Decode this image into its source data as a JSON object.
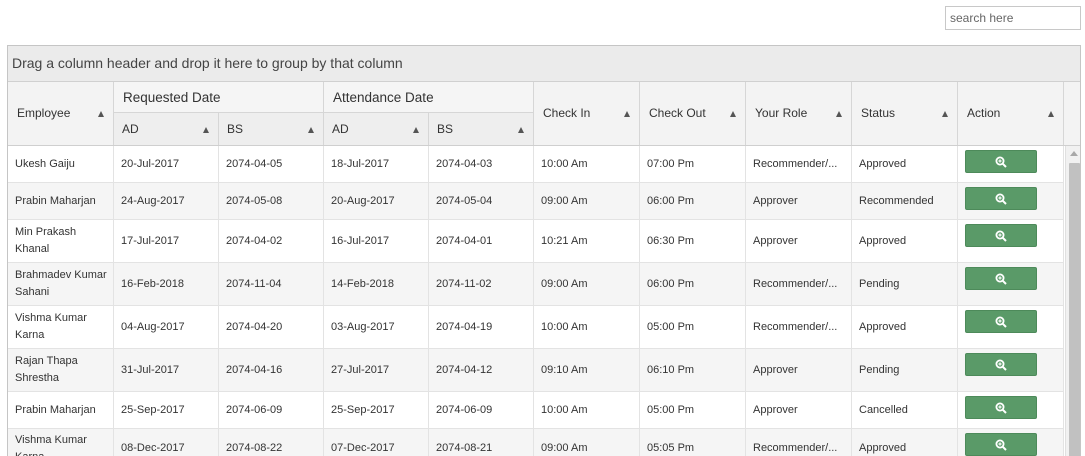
{
  "search": {
    "placeholder": "search here"
  },
  "grid": {
    "group_hint": "Drag a column header and drop it here to group by that column",
    "headers": {
      "employee": "Employee",
      "requested_date": "Requested Date",
      "attendance_date": "Attendance Date",
      "ad": "AD",
      "bs": "BS",
      "check_in": "Check In",
      "check_out": "Check Out",
      "your_role": "Your Role",
      "status": "Status",
      "action": "Action"
    },
    "rows": [
      {
        "employee": "Ukesh Gaiju",
        "req_ad": "20-Jul-2017",
        "req_bs": "2074-04-05",
        "att_ad": "18-Jul-2017",
        "att_bs": "2074-04-03",
        "check_in": "10:00 Am",
        "check_out": "07:00 Pm",
        "role": "Recommender/...",
        "status": "Approved"
      },
      {
        "employee": "Prabin Maharjan",
        "req_ad": "24-Aug-2017",
        "req_bs": "2074-05-08",
        "att_ad": "20-Aug-2017",
        "att_bs": "2074-05-04",
        "check_in": "09:00 Am",
        "check_out": "06:00 Pm",
        "role": "Approver",
        "status": "Recommended"
      },
      {
        "employee": "Min Prakash Khanal",
        "req_ad": "17-Jul-2017",
        "req_bs": "2074-04-02",
        "att_ad": "16-Jul-2017",
        "att_bs": "2074-04-01",
        "check_in": "10:21 Am",
        "check_out": "06:30 Pm",
        "role": "Approver",
        "status": "Approved"
      },
      {
        "employee": "Brahmadev Kumar Sahani",
        "req_ad": "16-Feb-2018",
        "req_bs": "2074-11-04",
        "att_ad": "14-Feb-2018",
        "att_bs": "2074-11-02",
        "check_in": "09:00 Am",
        "check_out": "06:00 Pm",
        "role": "Recommender/...",
        "status": "Pending"
      },
      {
        "employee": "Vishma Kumar Karna",
        "req_ad": "04-Aug-2017",
        "req_bs": "2074-04-20",
        "att_ad": "03-Aug-2017",
        "att_bs": "2074-04-19",
        "check_in": "10:00 Am",
        "check_out": "05:00 Pm",
        "role": "Recommender/...",
        "status": "Approved"
      },
      {
        "employee": "Rajan Thapa Shrestha",
        "req_ad": "31-Jul-2017",
        "req_bs": "2074-04-16",
        "att_ad": "27-Jul-2017",
        "att_bs": "2074-04-12",
        "check_in": "09:10 Am",
        "check_out": "06:10 Pm",
        "role": "Approver",
        "status": "Pending"
      },
      {
        "employee": "Prabin Maharjan",
        "req_ad": "25-Sep-2017",
        "req_bs": "2074-06-09",
        "att_ad": "25-Sep-2017",
        "att_bs": "2074-06-09",
        "check_in": "10:00 Am",
        "check_out": "05:00 Pm",
        "role": "Approver",
        "status": "Cancelled"
      },
      {
        "employee": "Vishma Kumar Karna",
        "req_ad": "08-Dec-2017",
        "req_bs": "2074-08-22",
        "att_ad": "07-Dec-2017",
        "att_bs": "2074-08-21",
        "check_in": "09:00 Am",
        "check_out": "05:05 Pm",
        "role": "Recommender/...",
        "status": "Approved"
      }
    ]
  },
  "icons": {
    "action_button": "zoom-in-icon"
  },
  "colors": {
    "action_button": "#5a9a68",
    "group_bar": "#ebebeb",
    "header": "#f3f3f3"
  }
}
